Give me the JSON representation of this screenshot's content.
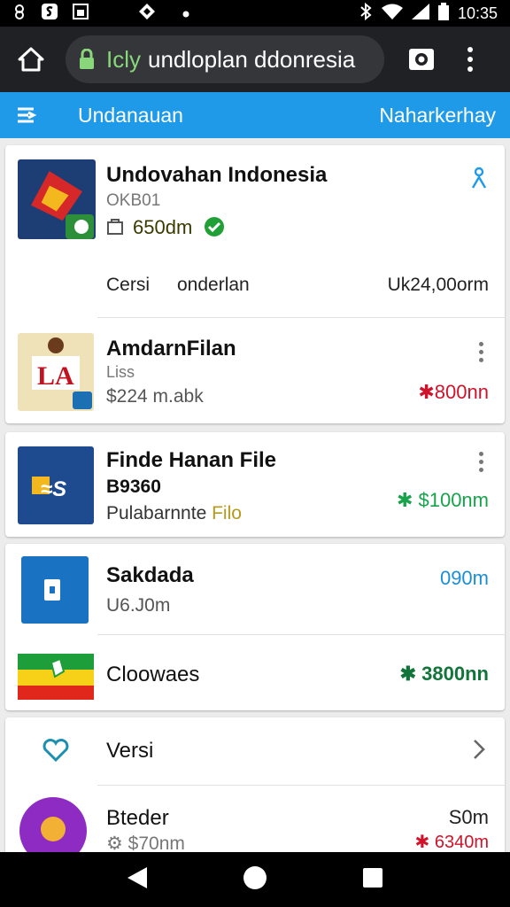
{
  "status_bar": {
    "time": "10:35",
    "left_icons": [
      "settings-icon",
      "s-app-icon",
      "image-icon",
      "diamond-icon",
      "dot-icon"
    ],
    "right_icons": [
      "bluetooth-icon",
      "wifi-icon",
      "signal-icon",
      "battery-icon"
    ]
  },
  "browser": {
    "url_scheme": "Icly",
    "url_host": "undloplan ddonresia"
  },
  "app_header": {
    "title": "Undanauan",
    "right_label": "Naharkerhay"
  },
  "cards": [
    {
      "title": "Undovahan Indonesia",
      "subtitle": "OKB01",
      "price_line": "650dm",
      "footer_left": "Cersi",
      "footer_mid": "onderlan",
      "footer_right": "Uk24,00orm"
    }
  ],
  "list_items": [
    {
      "title": "AmdarnFilan",
      "line2": "Liss",
      "line3": "$224 m.abk",
      "price": "✱800nn",
      "price_color": "#d0132a"
    },
    {
      "title": "Finde Hanan File",
      "line2": "B9360",
      "line3": "Pulabarnnte",
      "line3_accent": "Filo",
      "price": "✱ $100nm",
      "price_color": "#17a34a"
    },
    {
      "title": "Sakdada",
      "line2": "U6.J0m",
      "price": "090m",
      "price_color": "#1b8fd6"
    },
    {
      "title": "Cloowaes",
      "price": "✱ 3800nn",
      "price_color": "#11753a"
    },
    {
      "title": "Versi"
    },
    {
      "title": "Bteder",
      "line2": "⚙ $70nm",
      "price": "S0m",
      "price2": "✱ 6340m",
      "price2_color": "#d0132a"
    }
  ],
  "colors": {
    "header_blue": "#1e9ae8",
    "browser_dark": "#202124",
    "url_green": "#8ad77b"
  }
}
